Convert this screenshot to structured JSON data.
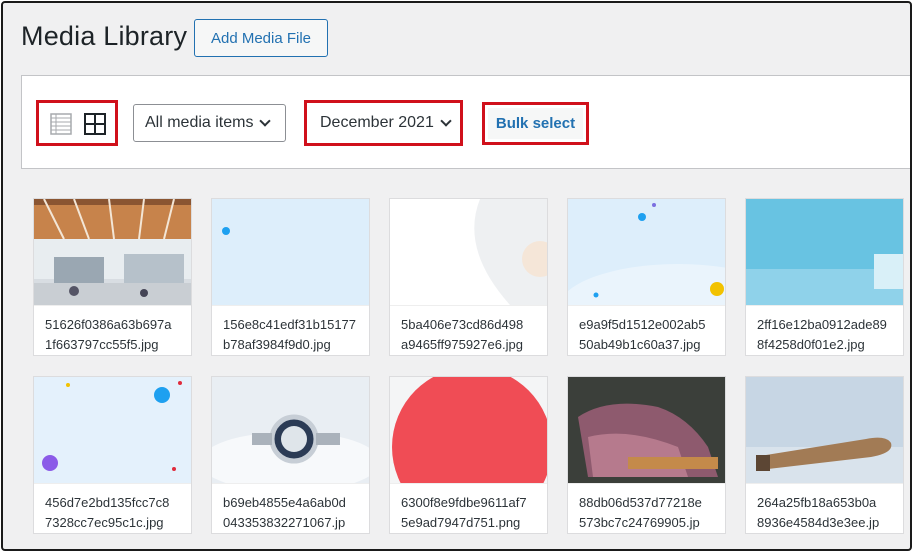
{
  "header": {
    "title": "Media Library",
    "add_button": "Add Media File"
  },
  "toolbar": {
    "view_list_icon": "list-view-icon",
    "view_grid_icon": "grid-view-icon",
    "type_filter": "All media items",
    "date_filter": "December 2021",
    "bulk_select": "Bulk select"
  },
  "media": [
    {
      "line1": "51626f0386a63b697a",
      "line2": "1f663797cc55f5.jpg"
    },
    {
      "line1": "156e8c41edf31b15177",
      "line2": "b78af3984f9d0.jpg"
    },
    {
      "line1": "5ba406e73cd86d498",
      "line2": "a9465ff975927e6.jpg"
    },
    {
      "line1": "e9a9f5d1512e002ab5",
      "line2": "50ab49b1c60a37.jpg"
    },
    {
      "line1": "2ff16e12ba0912ade89",
      "line2": "8f4258d0f01e2.jpg"
    },
    {
      "line1": "456d7e2bd135fcc7c8",
      "line2": "7328cc7ec95c1c.jpg"
    },
    {
      "line1": "b69eb4855e4a6ab0d",
      "line2": "043353832271067.jp"
    },
    {
      "line1": "6300f8e9fdbe9611af7",
      "line2": "5e9ad7947d751.png"
    },
    {
      "line1": "88db06d537d77218e",
      "line2": "573bc7c24769905.jp"
    },
    {
      "line1": "264a25fb18a653b0a",
      "line2": "8936e4584d3e3ee.jp"
    }
  ],
  "colors": {
    "accent": "#2271b1",
    "highlight": "#d0101b",
    "background": "#f0f0f1"
  }
}
